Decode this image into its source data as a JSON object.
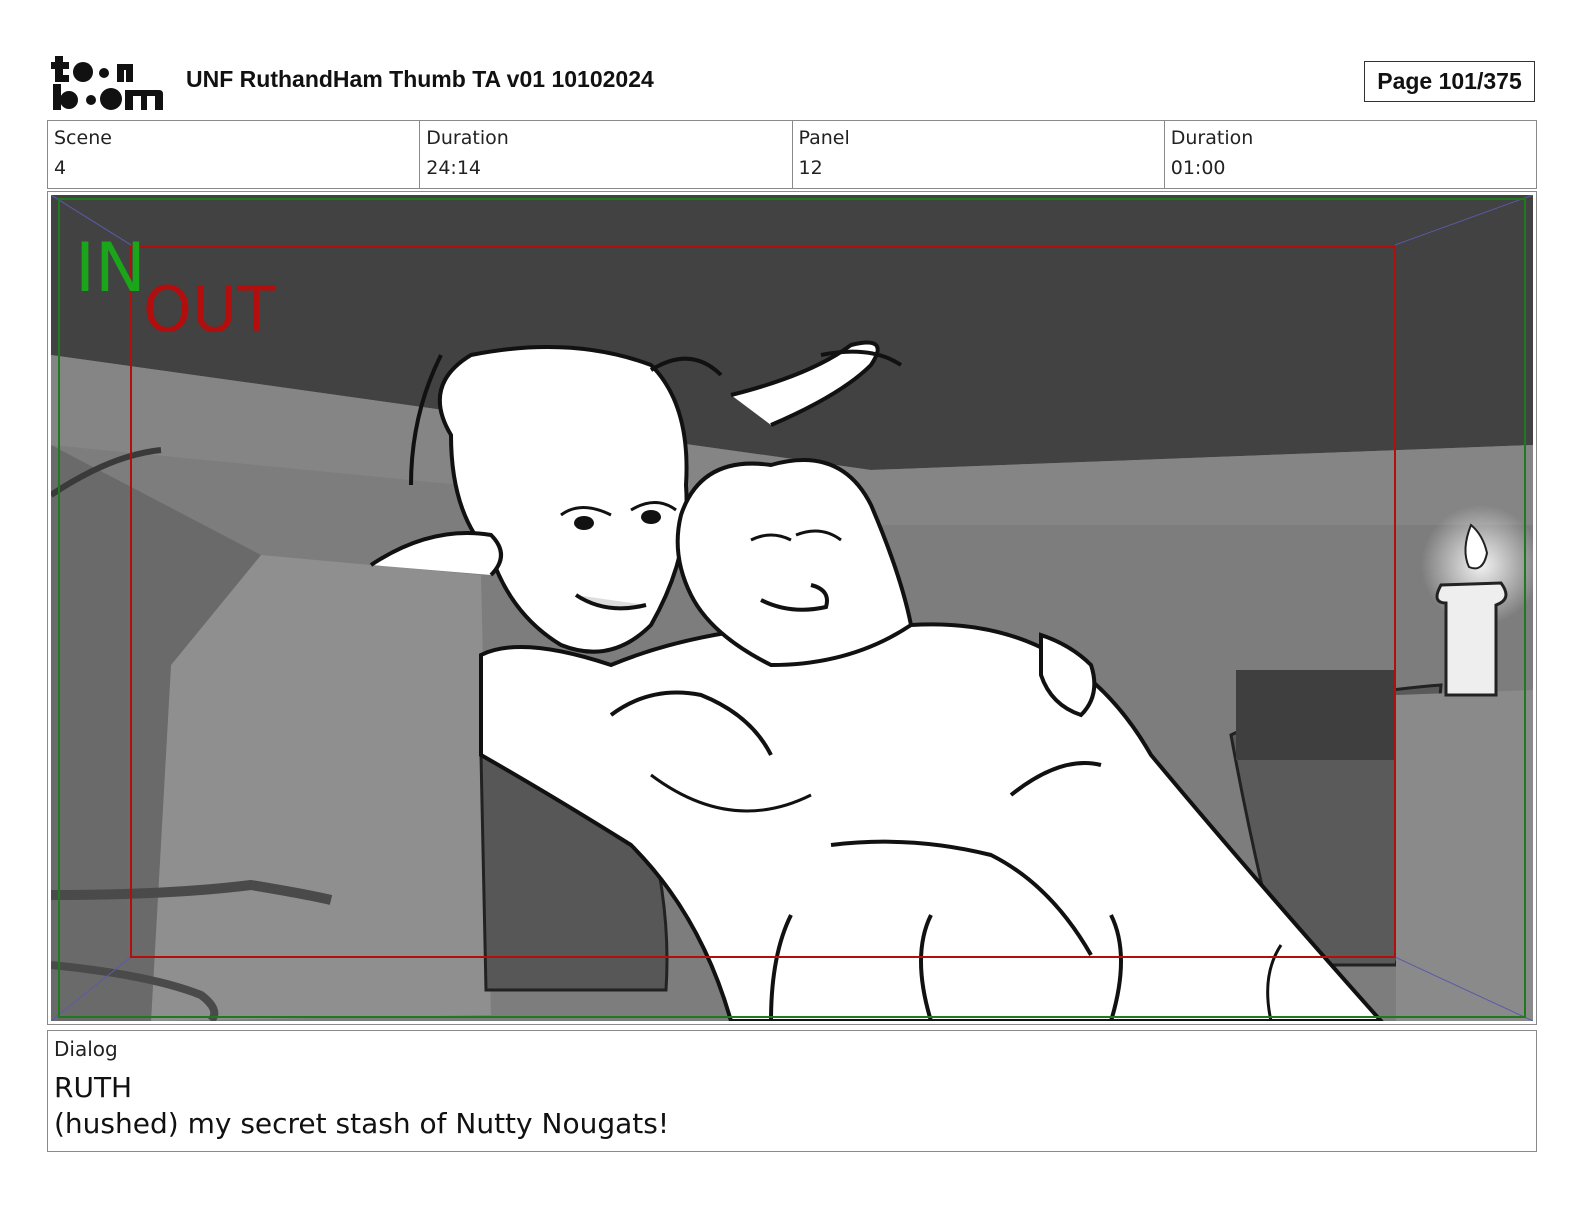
{
  "header": {
    "logo_text": "toon boom",
    "document_title": "UNF RuthandHam Thumb TA v01 10102024",
    "page_indicator": "Page 101/375"
  },
  "info": {
    "scene_label": "Scene",
    "scene_value": "4",
    "scene_duration_label": "Duration",
    "scene_duration_value": "24:14",
    "panel_label": "Panel",
    "panel_value": "12",
    "panel_duration_label": "Duration",
    "panel_duration_value": "01:00"
  },
  "panel": {
    "in_marker": "IN",
    "out_marker": "OUT",
    "in_color": "#1aa51a",
    "out_color": "#b20e0e"
  },
  "dialog": {
    "label": "Dialog",
    "speaker": "RUTH",
    "line": "(hushed) my secret stash of Nutty Nougats!"
  }
}
